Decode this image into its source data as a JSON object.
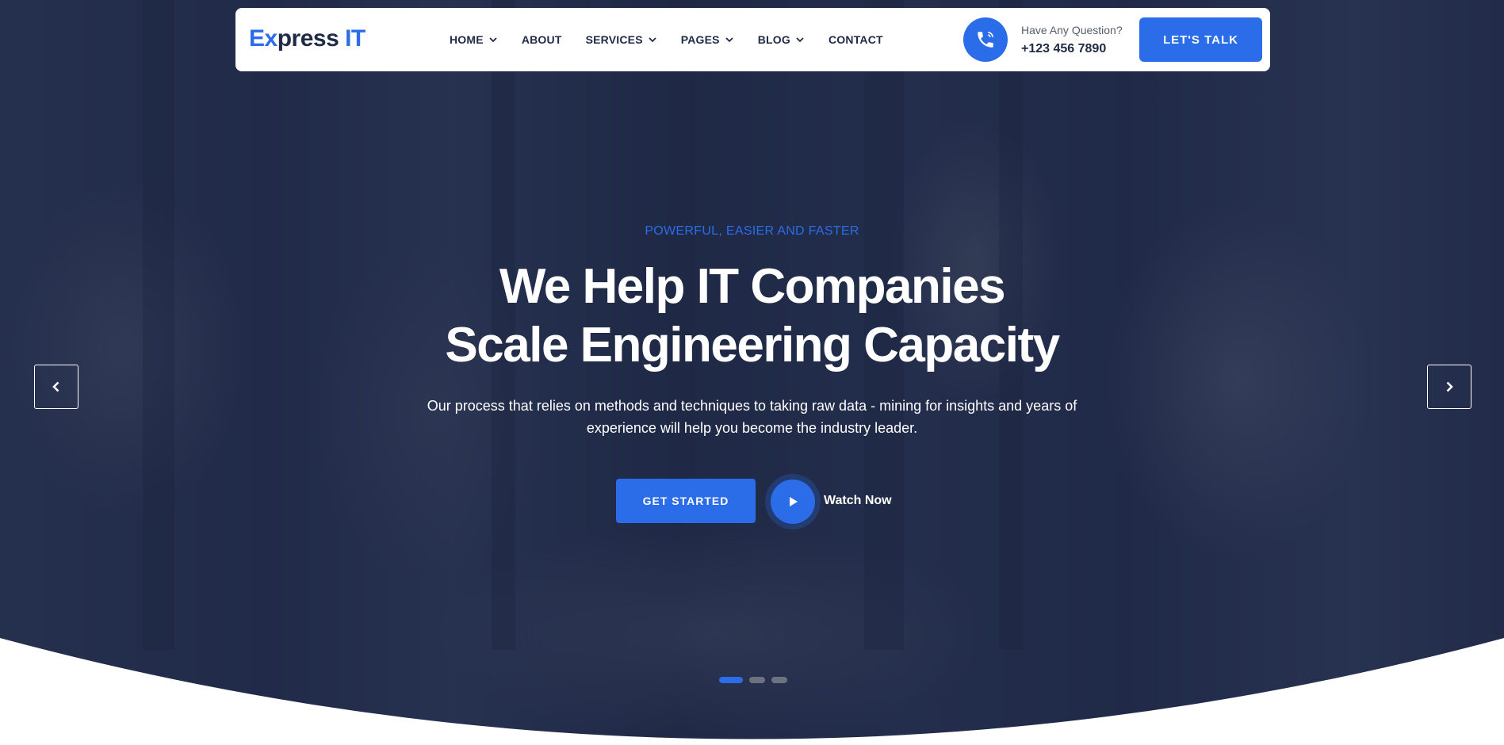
{
  "header": {
    "logo": {
      "prefix": "Ex",
      "middle": "press ",
      "suffix": "IT"
    },
    "nav": [
      {
        "label": "HOME",
        "has_dropdown": true
      },
      {
        "label": "ABOUT",
        "has_dropdown": false
      },
      {
        "label": "SERVICES",
        "has_dropdown": true
      },
      {
        "label": "PAGES",
        "has_dropdown": true
      },
      {
        "label": "BLOG",
        "has_dropdown": true
      },
      {
        "label": "CONTACT",
        "has_dropdown": false
      }
    ],
    "contact": {
      "question": "Have Any Question?",
      "phone": "+123 456 7890",
      "icon": "phone-icon"
    },
    "cta_label": "LET'S TALK"
  },
  "hero": {
    "tagline": "POWERFUL, EASIER AND FASTER",
    "headline_line1": "We Help IT Companies",
    "headline_line2": "Scale Engineering Capacity",
    "description": "Our process that relies on methods and techniques to taking raw data - mining for insights and years of experience will help you become the industry leader.",
    "primary_button": "GET STARTED",
    "video_label": "Watch Now",
    "slides_total": 3,
    "active_slide": 1
  },
  "colors": {
    "accent": "#2b6de8",
    "dark_text": "#1f2a44",
    "overlay": "#1c2644"
  }
}
